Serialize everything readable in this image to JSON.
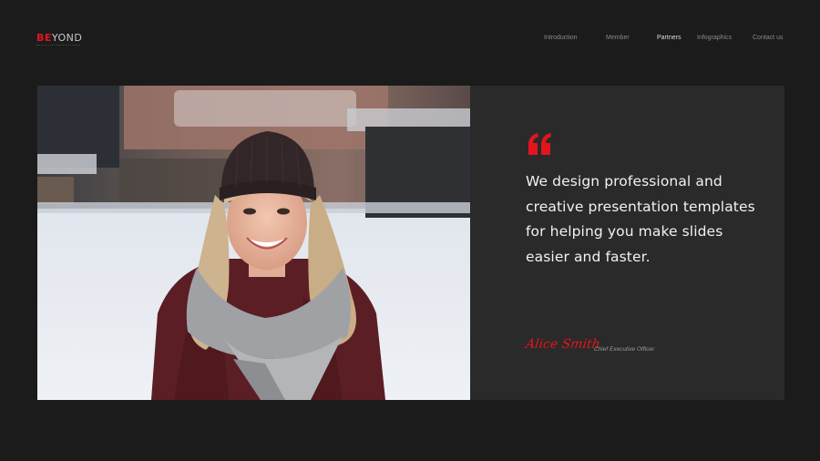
{
  "brand": {
    "logo_part1": "BE",
    "logo_part2": "YOND"
  },
  "nav": {
    "items": [
      {
        "label": "Introduction",
        "active": false
      },
      {
        "label": "Member",
        "active": false
      },
      {
        "label": "Partners",
        "active": true
      },
      {
        "label": "Infographics",
        "active": false
      },
      {
        "label": "Contact us",
        "active": false
      }
    ]
  },
  "testimonial": {
    "quote_icon": "quote-icon",
    "quote": "We design professional and creative presentation templates for helping you make slides easier and faster.",
    "signature": "Alice Smith",
    "role": "Chief Executive Officer"
  },
  "photo": {
    "subject": "portrait-photo"
  },
  "colors": {
    "accent": "#e3151c",
    "background": "#1b1b1c",
    "panel": "#2a2a2b",
    "text": "#f2f2f2"
  }
}
